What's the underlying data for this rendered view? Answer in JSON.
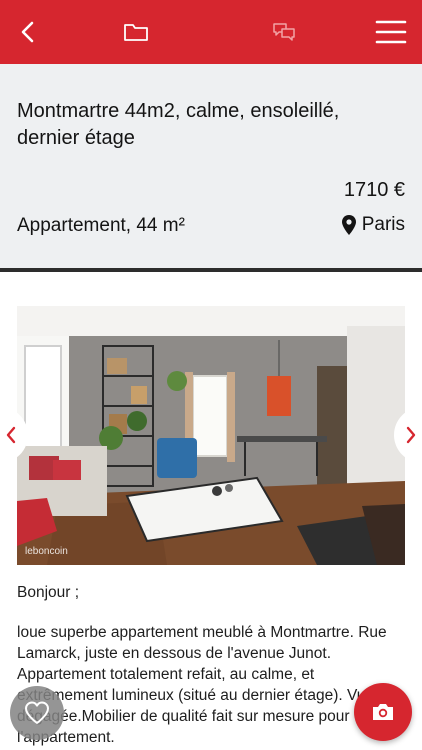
{
  "topbar": {
    "icons": [
      "chevron-left-icon",
      "folder-icon",
      "chat-icon",
      "hamburger-menu-icon"
    ],
    "background": "#d6262f"
  },
  "listing": {
    "title": "Montmartre 44m2, calme, ensoleillé, dernier étage",
    "price": "1710 €",
    "subtitle": "Appartement, 44 m²",
    "location": "Paris"
  },
  "photo": {
    "watermark": "leboncoin"
  },
  "description": {
    "greeting": "Bonjour ;",
    "body": "loue superbe appartement meublé à Montmartre. Rue Lamarck, juste en dessous de l'avenue Junot. Appartement totalement refait, au calme, et extrêmement lumineux (situé au dernier étage). Vue dégagée.Mobilier de qualité fait sur mesure pour l'appartement."
  },
  "actions": {
    "favorite_icon": "heart-icon",
    "photo_icon": "camera-icon",
    "accent": "#d6262f"
  }
}
